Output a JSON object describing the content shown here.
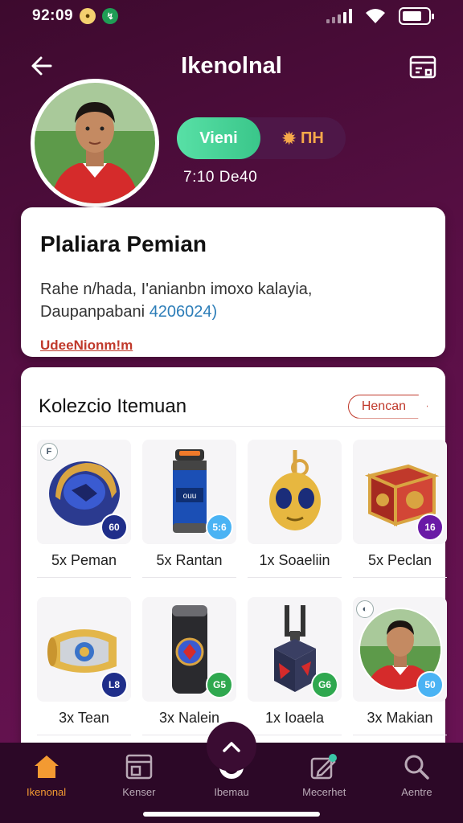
{
  "status_bar": {
    "time": "92:09"
  },
  "header": {
    "title": "Ikenolnal"
  },
  "profile": {
    "toggle_on": "Vieni",
    "toggle_off": "ПН",
    "points": "7:10 De40"
  },
  "info_card": {
    "title": "Plaliara Pemian",
    "line1": "Rahe n/hada, I'anianbn imoxo kalayia,",
    "line2_prefix": "Daupanpabani ",
    "line2_code": "4206024)",
    "link": "UdeeNionm!m"
  },
  "collection": {
    "title": "Kolezcio Itemuan",
    "button": "Hencan",
    "items": [
      {
        "label": "5x Peman",
        "badge": "60",
        "badge_color": "#1f2e8a",
        "icon": "helmet-icon"
      },
      {
        "label": "5x Rantan",
        "badge": "5:6",
        "badge_color": "#4ab3f4",
        "icon": "bottle-icon"
      },
      {
        "label": "1x Soaeliin",
        "badge": "",
        "badge_color": "",
        "icon": "alien-keychain-icon"
      },
      {
        "label": "5x Peclan",
        "badge": "16",
        "badge_color": "#6a1aa6",
        "icon": "chest-icon"
      },
      {
        "label": "3x Tean",
        "badge": "L8",
        "badge_color": "#1f2e8a",
        "icon": "armband-icon"
      },
      {
        "label": "3x Nalein",
        "badge": "G5",
        "badge_color": "#2fa84f",
        "icon": "can-icon"
      },
      {
        "label": "1x Ioaela",
        "badge": "G6",
        "badge_color": "#2fa84f",
        "icon": "lantern-icon"
      },
      {
        "label": "3x Makian",
        "badge": "50",
        "badge_color": "#4ab3f4",
        "icon": "player-icon"
      }
    ]
  },
  "nav": [
    {
      "label": "Ikenonal",
      "icon": "home-icon"
    },
    {
      "label": "Kenser",
      "icon": "inbox-icon"
    },
    {
      "label": "Ibemau",
      "icon": "circle-icon"
    },
    {
      "label": "Mecerhet",
      "icon": "edit-icon"
    },
    {
      "label": "Aentre",
      "icon": "search-icon"
    }
  ],
  "colors": {
    "accent": "#f39a32",
    "toggle": "#3ac68a",
    "background": "#5a0f46"
  }
}
